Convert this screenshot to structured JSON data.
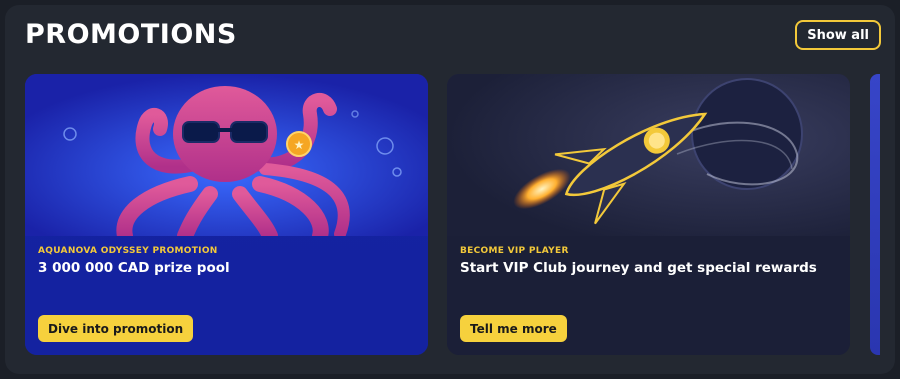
{
  "header": {
    "title": "PROMOTIONS",
    "show_all_label": "Show all"
  },
  "promotions": [
    {
      "eyebrow": "AQUANOVA ODYSSEY PROMOTION",
      "headline": "3 000 000 CAD prize pool",
      "cta_label": "Dive into promotion",
      "illustration_icon": "octopus-with-sunglasses-icon"
    },
    {
      "eyebrow": "BECOME VIP PLAYER",
      "headline": "Start VIP Club journey and get special rewards",
      "cta_label": "Tell me more",
      "illustration_icon": "rocket-icon"
    }
  ],
  "colors": {
    "background": "#232831",
    "accent": "#f3c93a",
    "button": "#f6d13d"
  }
}
